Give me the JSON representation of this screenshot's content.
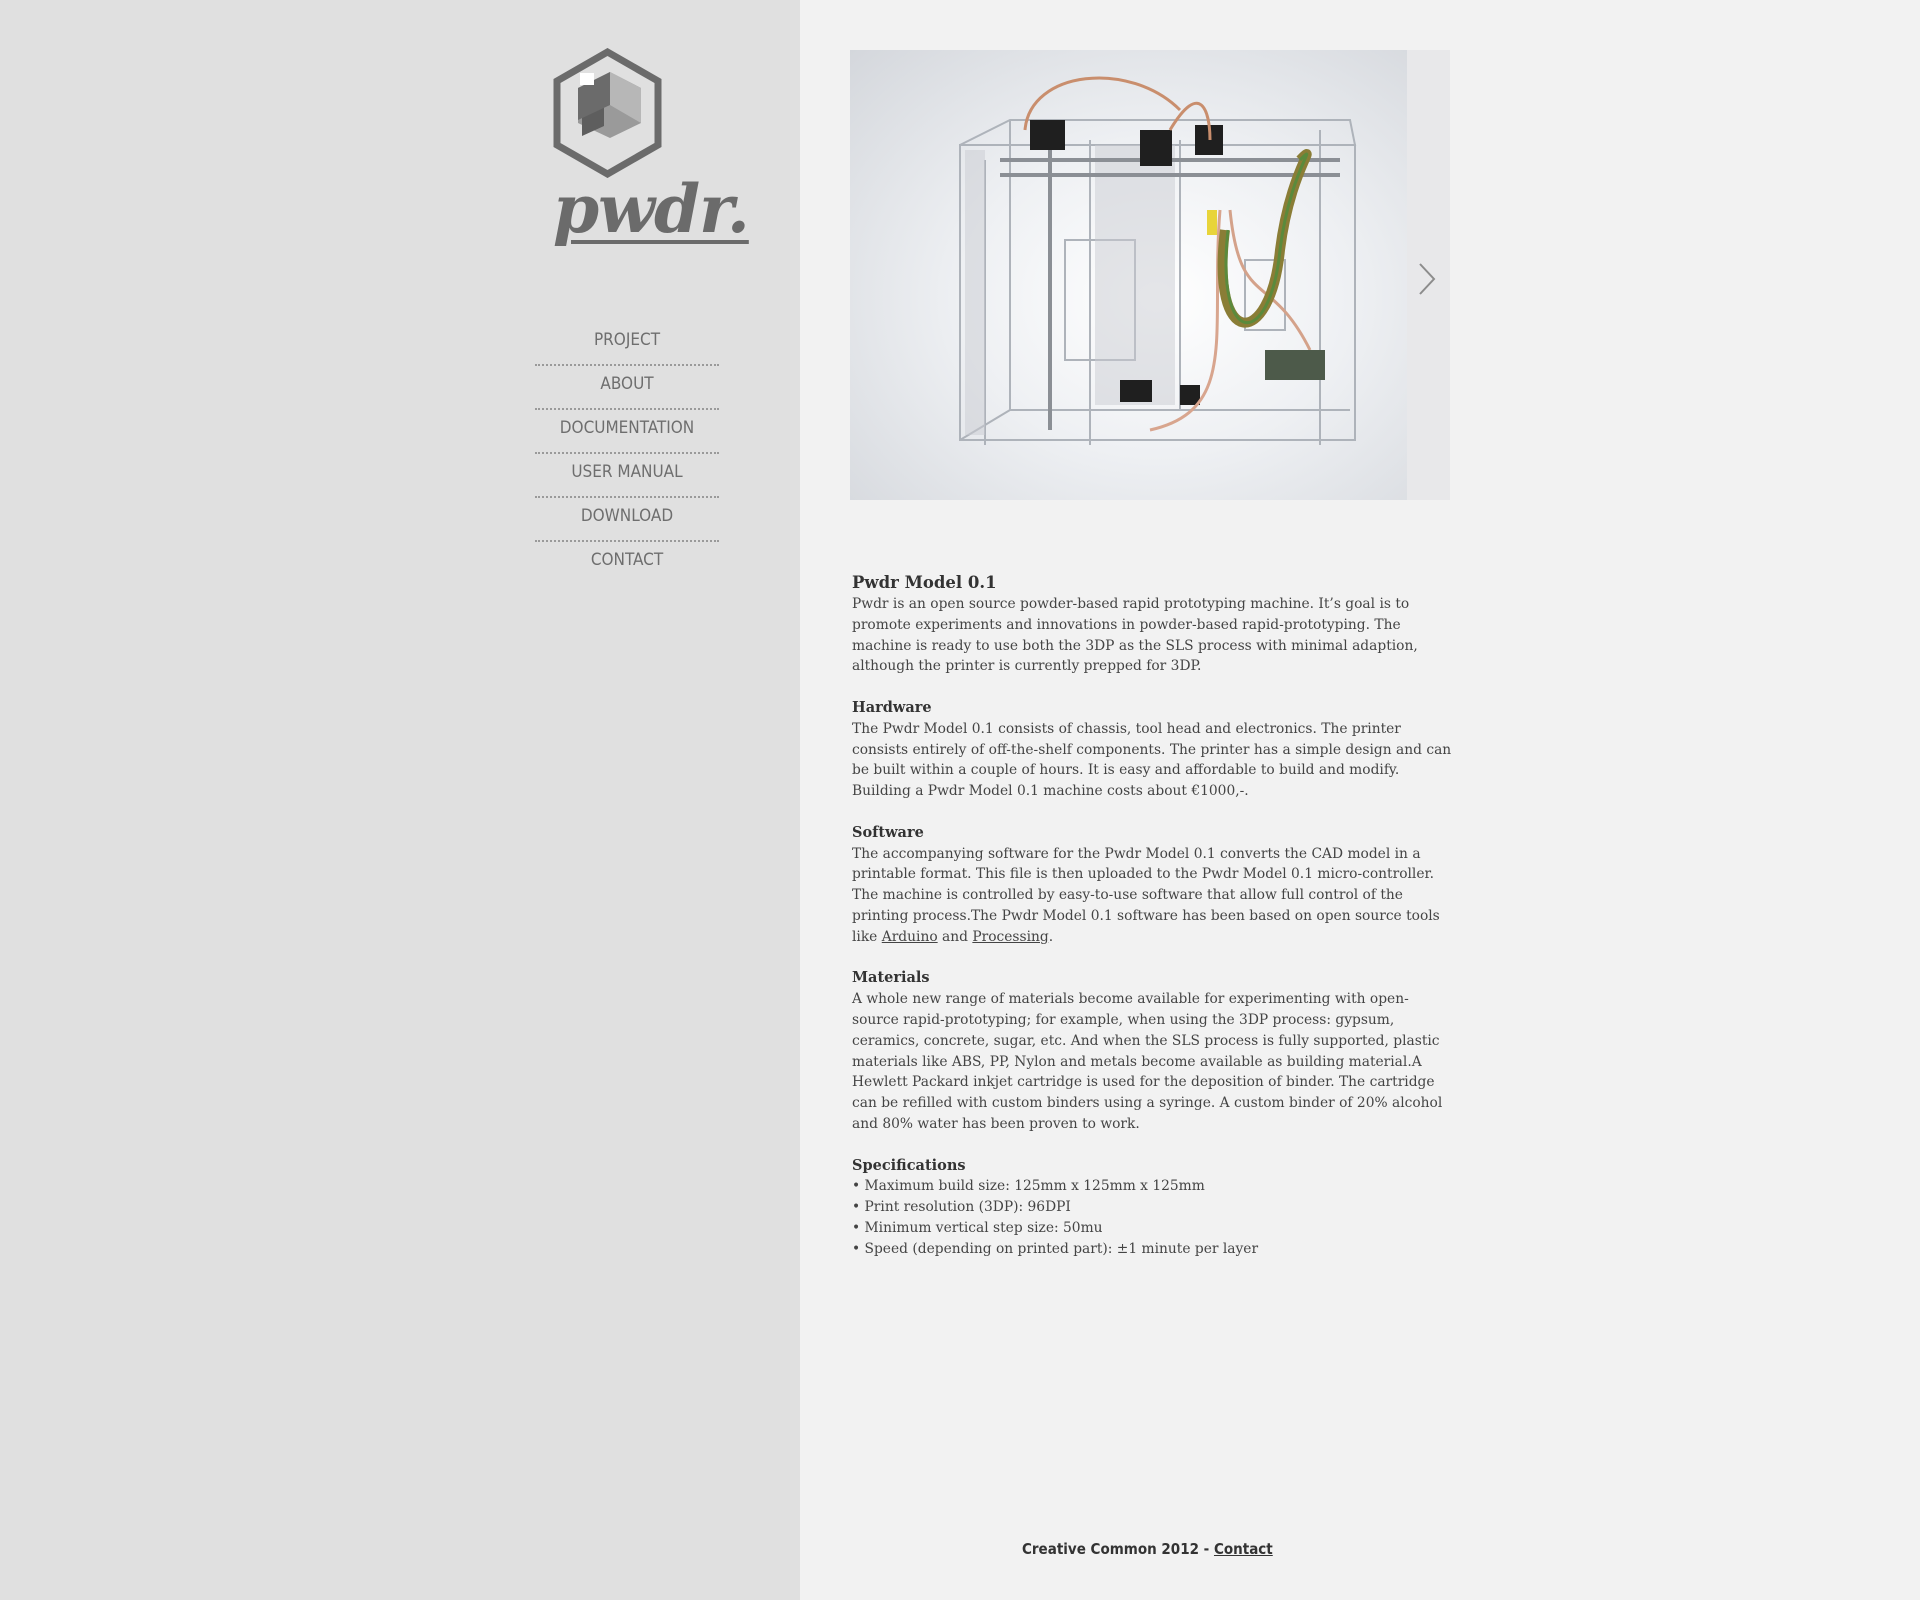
{
  "brand": {
    "wordmark": "pwdr."
  },
  "nav": {
    "items": [
      {
        "label": "PROJECT"
      },
      {
        "label": "ABOUT"
      },
      {
        "label": "DOCUMENTATION"
      },
      {
        "label": "USER MANUAL"
      },
      {
        "label": "DOWNLOAD"
      },
      {
        "label": "CONTACT"
      }
    ]
  },
  "colors": {
    "sidebar_bg": "#e0e0e0",
    "page_bg": "#f2f2f2",
    "logo_gray": "#6b6b6b",
    "text": "#444444"
  },
  "slider": {
    "next_icon": "chevron-right-icon"
  },
  "article": {
    "title": "Pwdr Model 0.1",
    "intro": "Pwdr is an open source powder-based rapid prototyping machine. It’s goal is to promote experiments and innovations in powder-based rapid-prototyping. The machine is ready to use both the 3DP as the SLS process with minimal adaption, although the printer is currently prepped for 3DP.",
    "hardware": {
      "heading": "Hardware",
      "text": "The Pwdr Model 0.1 consists of chassis, tool head and electronics. The printer consists entirely of off-the-shelf components. The printer has a simple design and can be built within a couple of hours. It is easy and affordable to build and modify. Building a Pwdr Model 0.1 machine costs about €1000,-."
    },
    "software": {
      "heading": "Software",
      "text_before": "The accompanying software for the Pwdr Model 0.1 converts the CAD model in a printable format. This file is then uploaded to the Pwdr Model 0.1 micro-controller. The machine is controlled by easy-to-use software that allow full control of the printing process.The Pwdr Model 0.1 software has been based on open source tools like ",
      "link1": "Arduino",
      "text_mid": " and ",
      "link2": "Processing",
      "text_after": "."
    },
    "materials": {
      "heading": "Materials",
      "text": "A whole new range of materials become available for experimenting with open-source rapid-prototyping; for example, when using the 3DP process: gypsum, ceramics, concrete, sugar, etc. And when the SLS process is fully supported, plastic materials like ABS, PP, Nylon and metals become available as building material.A Hewlett Packard inkjet cartridge is used for the deposition of binder. The cartridge can be refilled with custom binders using a syringe. A custom binder of 20% alcohol and 80% water has been proven to work."
    },
    "specifications": {
      "heading": "Specifications",
      "items": [
        "• Maximum build size: 125mm x 125mm x 125mm",
        "• Print resolution (3DP): 96DPI",
        "• Minimum vertical step size: 50mu",
        "• Speed (depending on printed part): ±1 minute per layer"
      ]
    }
  },
  "footer": {
    "text": "Creative Common 2012 - ",
    "link": "Contact"
  }
}
